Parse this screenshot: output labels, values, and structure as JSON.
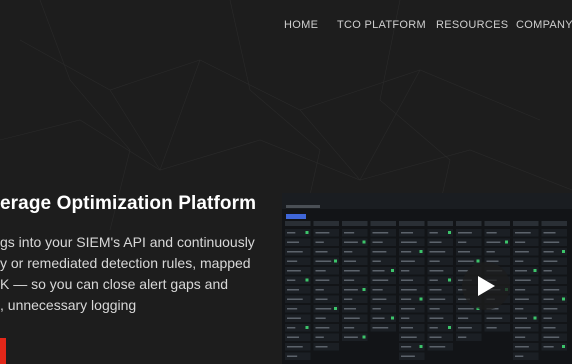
{
  "nav": {
    "items": [
      "HOME",
      "TCO PLATFORM",
      "RESOURCES",
      "COMPANY"
    ]
  },
  "hero": {
    "title": "erage Optimization Platform",
    "description_lines": [
      "gs into your SIEM's API and continuously",
      "y or remediated detection rules, mapped",
      "K — so you can close alert gaps and",
      ", unnecessary logging"
    ]
  },
  "video": {
    "icon": "play-icon"
  },
  "colors": {
    "background": "#1d1d1d",
    "accent": "#e32719",
    "text": "#ffffff",
    "matrix_green": "#3cc46a"
  }
}
